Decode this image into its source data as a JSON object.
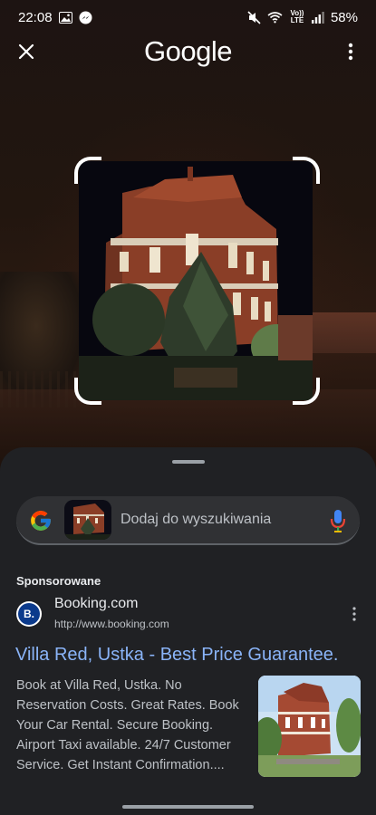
{
  "status_bar": {
    "time": "22:08",
    "battery": "58%",
    "left_icons": [
      "gallery-icon",
      "messenger-icon"
    ],
    "right_icons": [
      "mute-icon",
      "wifi-call-icon",
      "volte-icon",
      "signal-icon"
    ],
    "volte_label": "Vo)) LTE"
  },
  "header": {
    "logo": "Google",
    "close_icon": "close-icon",
    "more_icon": "more-vert-icon"
  },
  "search": {
    "placeholder": "Dodaj do wyszukiwania",
    "mic_icon": "mic-icon"
  },
  "result": {
    "sponsored_label": "Sponsorowane",
    "site_name": "Booking.com",
    "site_url": "http://www.booking.com",
    "logo_text": "B.",
    "title": "Villa Red, Ustka - Best Price Guarantee.",
    "description": "Book at Villa Red, Ustka. No Reservation Costs. Great Rates. Book Your Car Rental. Secure Booking. Airport Taxi available. 24/7 Customer Service. Get Instant Confirmation...."
  },
  "colors": {
    "link": "#8ab4f8",
    "sheet_bg": "#202124",
    "booking_blue": "#0b3a8c"
  }
}
